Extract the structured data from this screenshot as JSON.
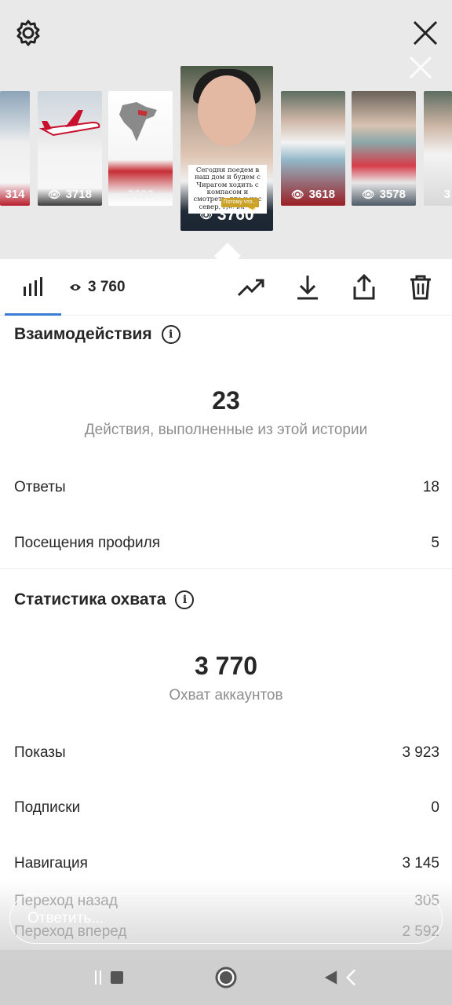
{
  "stories": [
    {
      "views": "314"
    },
    {
      "views": "3718"
    },
    {
      "views": "3693"
    },
    {
      "views": "3760",
      "caption": "Сегодня поедем в наш дом и будем с Чирагом ходить с компасом и смотреть, где у нас север, где юг 😊",
      "tag": "Потому что..."
    },
    {
      "views": "3618"
    },
    {
      "views": "3578"
    },
    {
      "views": "3"
    }
  ],
  "toolbar": {
    "views": "3 760",
    "icons": [
      "bar-chart-icon",
      "eye-icon",
      "trending-icon",
      "download-icon",
      "share-icon",
      "trash-icon"
    ]
  },
  "interactions": {
    "title": "Взаимодействия",
    "total": "23",
    "subtitle": "Действия, выполненные из этой истории",
    "rows": [
      {
        "label": "Ответы",
        "value": "18"
      },
      {
        "label": "Посещения профиля",
        "value": "5"
      }
    ]
  },
  "reach": {
    "title": "Статистика охвата",
    "total": "3 770",
    "subtitle": "Охват аккаунтов",
    "rows": [
      {
        "label": "Показы",
        "value": "3 923"
      },
      {
        "label": "Подписки",
        "value": "0"
      },
      {
        "label": "Навигация",
        "value": "3 145"
      },
      {
        "label": "Переход назад",
        "value": "305"
      },
      {
        "label": "Переход вперед",
        "value": "2 592"
      }
    ]
  },
  "reply": {
    "placeholder": "Ответить..."
  },
  "colors": {
    "accent_underline": "#3a7bd5",
    "text": "#262626",
    "muted": "#8e8e8e"
  }
}
